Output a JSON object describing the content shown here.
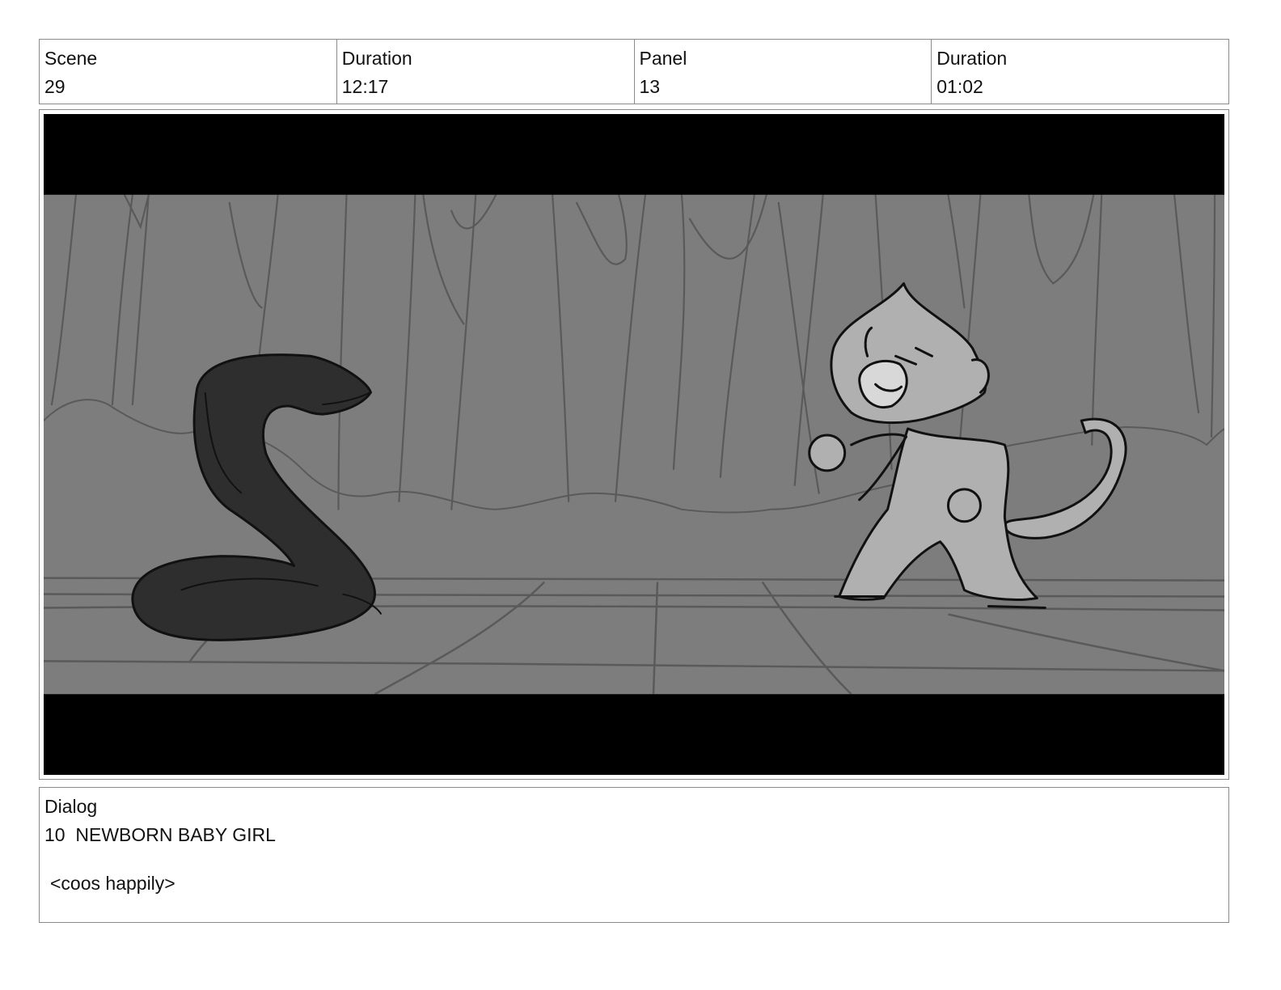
{
  "header": {
    "scene_label": "Scene",
    "scene_value": "29",
    "scene_duration_label": "Duration",
    "scene_duration_value": "12:17",
    "panel_label": "Panel",
    "panel_value": "13",
    "panel_duration_label": "Duration",
    "panel_duration_value": "01:02"
  },
  "panel": {
    "letterbox_color": "#000000",
    "background_color": "#7d7d7d",
    "snake_color": "#2e2e2e",
    "monkey_color": "#b0b0b0"
  },
  "dialog": {
    "label": "Dialog",
    "speaker": "10  NEWBORN BABY GIRL",
    "line": "<coos happily>"
  }
}
